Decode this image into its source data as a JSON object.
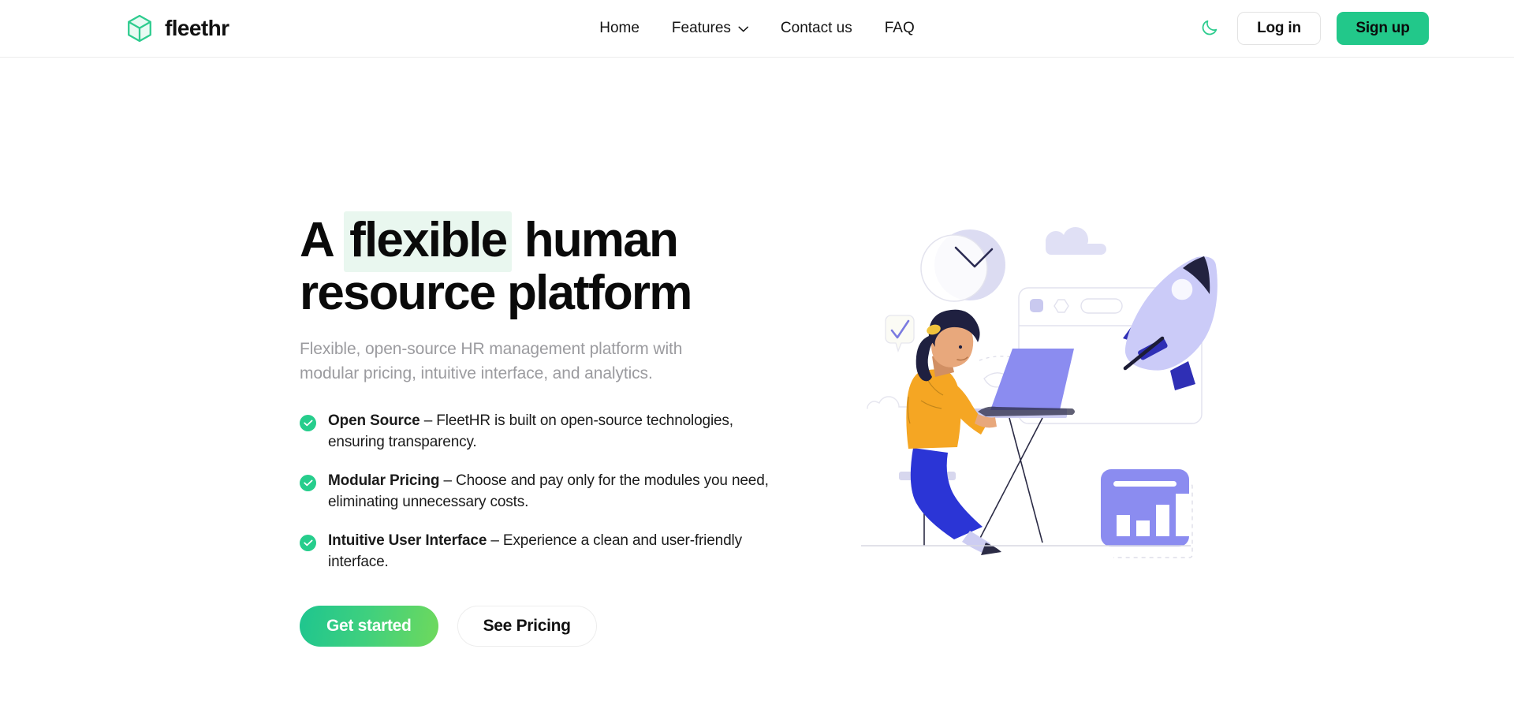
{
  "header": {
    "brand": {
      "name": "fleethr",
      "logo_icon": "cube-icon",
      "logo_color": "#2ecc8f"
    },
    "nav": [
      {
        "label": "Home",
        "icon": null
      },
      {
        "label": "Features",
        "icon": "chevron-down-icon"
      },
      {
        "label": "Contact us",
        "icon": null
      },
      {
        "label": "FAQ",
        "icon": null
      }
    ],
    "theme_toggle": {
      "icon": "moon-icon",
      "color": "#2ecc8f"
    },
    "login_label": "Log in",
    "signup_label": "Sign up",
    "signup_color": "#22c88a"
  },
  "hero": {
    "headline": {
      "before": "A ",
      "highlight": "flexible",
      "after": " human resource platform",
      "highlight_bg": "#e9f7ef"
    },
    "subhead": "Flexible, open-source HR management platform with modular pricing, intuitive interface, and analytics.",
    "features": [
      {
        "title": "Open Source",
        "body": " – FleetHR is built on open-source technologies, ensuring transparency.",
        "icon": "check-circle-icon"
      },
      {
        "title": "Modular Pricing",
        "body": " – Choose and pay only for the modules you need, eliminating unnecessary costs.",
        "icon": "check-circle-icon"
      },
      {
        "title": "Intuitive User Interface",
        "body": " – Experience a clean and user-friendly interface.",
        "icon": "check-circle-icon"
      }
    ],
    "cta_primary": "Get started",
    "cta_secondary": "See Pricing",
    "illustration": {
      "name": "woman-at-laptop-illustration",
      "elements": [
        "clock",
        "cloud",
        "checkmark-speech-bubble",
        "browser-window",
        "rocket",
        "woman-at-desk",
        "bar-chart-card"
      ],
      "colors": {
        "lavender": "#8b8cf0",
        "light_lavender": "#cfcff7",
        "navy": "#2f2fb5",
        "dark": "#1f1f3d",
        "shirt": "#f5a623",
        "pants": "#2b35d6",
        "skin": "#e8a87c"
      }
    }
  }
}
